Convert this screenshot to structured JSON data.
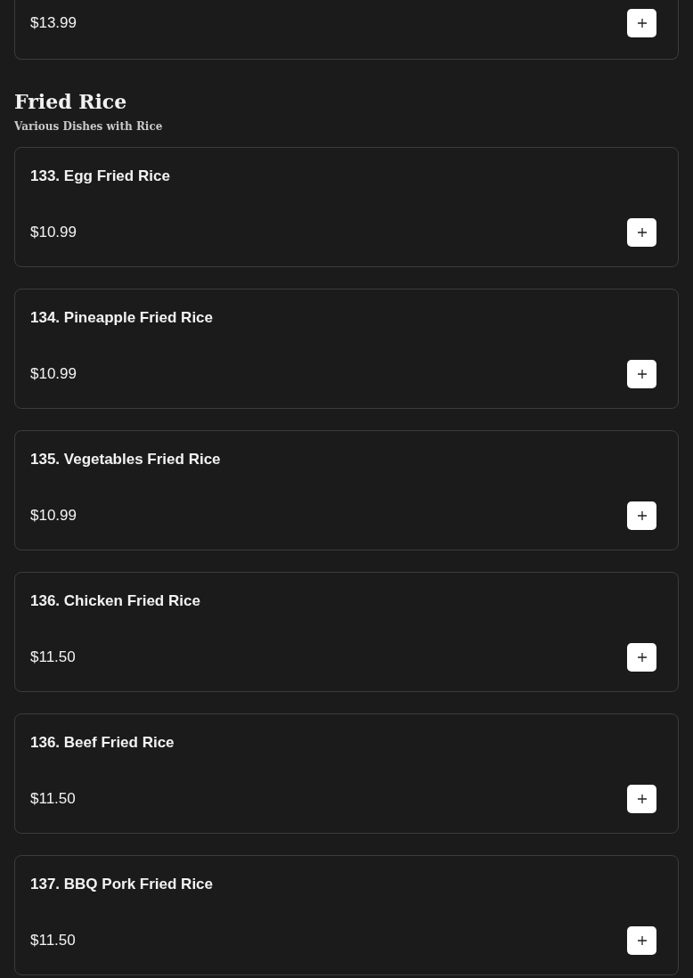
{
  "previous_item": {
    "price": "$13.99"
  },
  "section": {
    "title": "Fried Rice",
    "subtitle": "Various Dishes with Rice"
  },
  "items": [
    {
      "name": "133. Egg Fried Rice",
      "price": "$10.99"
    },
    {
      "name": "134. Pineapple Fried Rice",
      "price": "$10.99"
    },
    {
      "name": "135. Vegetables Fried Rice",
      "price": "$10.99"
    },
    {
      "name": "136. Chicken Fried Rice",
      "price": "$11.50"
    },
    {
      "name": "136. Beef Fried Rice",
      "price": "$11.50"
    },
    {
      "name": "137. BBQ Pork Fried Rice",
      "price": "$11.50"
    }
  ]
}
